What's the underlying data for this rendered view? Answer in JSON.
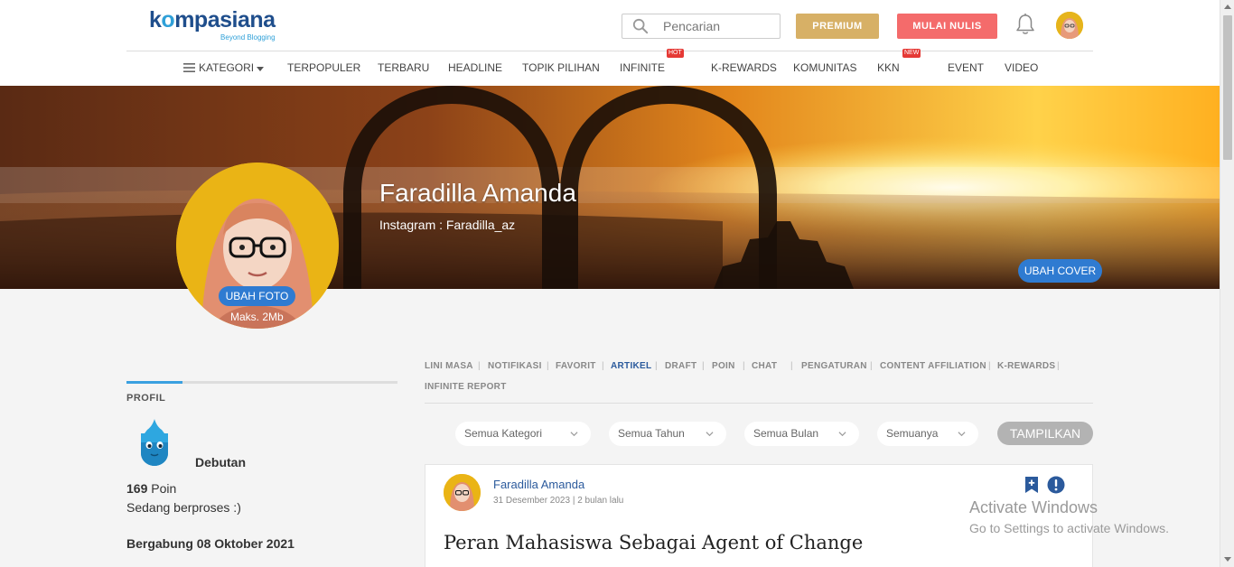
{
  "header": {
    "logo_text_pre": "k",
    "logo_text_o": "o",
    "logo_text_post": "mpasiana",
    "logo_tagline": "Beyond Blogging",
    "search_placeholder": "Pencarian",
    "premium_label": "PREMIUM",
    "write_label": "MULAI NULIS"
  },
  "nav": {
    "items": [
      {
        "label": "KATEGORI"
      },
      {
        "label": "TERPOPULER"
      },
      {
        "label": "TERBARU"
      },
      {
        "label": "HEADLINE"
      },
      {
        "label": "TOPIK PILIHAN"
      },
      {
        "label": "INFINITE",
        "badge": "HOT"
      },
      {
        "label": "K-REWARDS"
      },
      {
        "label": "KOMUNITAS"
      },
      {
        "label": "KKN",
        "badge": "NEW"
      },
      {
        "label": "EVENT"
      },
      {
        "label": "VIDEO"
      }
    ]
  },
  "profile": {
    "name": "Faradilla Amanda",
    "bio": "Instagram : Faradilla_az",
    "change_cover": "UBAH COVER",
    "change_photo": "UBAH FOTO",
    "photo_max": "Maks. 2Mb"
  },
  "sidebar": {
    "title": "PROFIL",
    "rank": "Debutan",
    "points_value": "169",
    "points_unit": " Poin",
    "status": "Sedang berproses :)",
    "joined": "Bergabung 08 Oktober 2021"
  },
  "tabs": {
    "items": [
      {
        "label": "LINI MASA"
      },
      {
        "label": "NOTIFIKASI"
      },
      {
        "label": "FAVORIT"
      },
      {
        "label": "ARTIKEL",
        "active": true
      },
      {
        "label": "DRAFT"
      },
      {
        "label": "POIN"
      },
      {
        "label": "CHAT"
      },
      {
        "label": "PENGATURAN"
      },
      {
        "label": "CONTENT AFFILIATION"
      },
      {
        "label": "K-REWARDS"
      },
      {
        "label": "INFINITE REPORT"
      }
    ]
  },
  "filters": {
    "category": "Semua Kategori",
    "year": "Semua Tahun",
    "month": "Semua Bulan",
    "type": "Semuanya",
    "show_label": "TAMPILKAN"
  },
  "article": {
    "author": "Faradilla Amanda",
    "date": "31 Desember 2023 | 2 bulan lalu",
    "title": "Peran Mahasiswa Sebagai Agent of Change"
  },
  "watermark": {
    "title": "Activate Windows",
    "subtitle": "Go to Settings to activate Windows."
  },
  "colors": {
    "brand_blue": "#1f4e8c",
    "premium": "#d7b066",
    "write": "#f46b6b",
    "action_blue": "#2f7bd1",
    "active_tab": "#2b5a9c"
  }
}
